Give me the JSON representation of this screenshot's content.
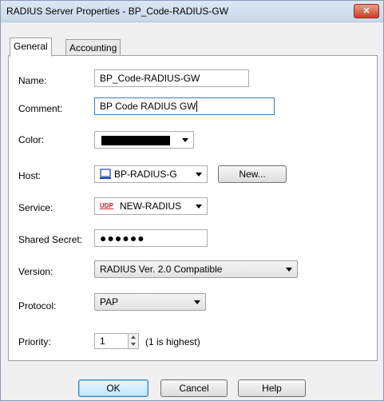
{
  "window": {
    "title": "RADIUS Server Properties - BP_Code-RADIUS-GW",
    "close_label": "✕"
  },
  "tabs": [
    {
      "label": "General",
      "active": true
    },
    {
      "label": "Accounting",
      "active": false
    }
  ],
  "form": {
    "name": {
      "label": "Name:",
      "value": "BP_Code-RADIUS-GW"
    },
    "comment": {
      "label": "Comment:",
      "value": "BP Code RADIUS GW"
    },
    "color": {
      "label": "Color:",
      "value_hex": "#000000"
    },
    "host": {
      "label": "Host:",
      "value": "BP-RADIUS-G",
      "icon": "host-object-icon",
      "new_button": "New..."
    },
    "service": {
      "label": "Service:",
      "value": "NEW-RADIUS",
      "icon_text": "UDP"
    },
    "shared_secret": {
      "label": "Shared Secret:",
      "value": "●●●●●●"
    },
    "version": {
      "label": "Version:",
      "value": "RADIUS Ver. 2.0 Compatible"
    },
    "protocol": {
      "label": "Protocol:",
      "value": "PAP"
    },
    "priority": {
      "label": "Priority:",
      "value": "1",
      "hint": "(1 is highest)"
    }
  },
  "buttons": {
    "ok": "OK",
    "cancel": "Cancel",
    "help": "Help"
  }
}
